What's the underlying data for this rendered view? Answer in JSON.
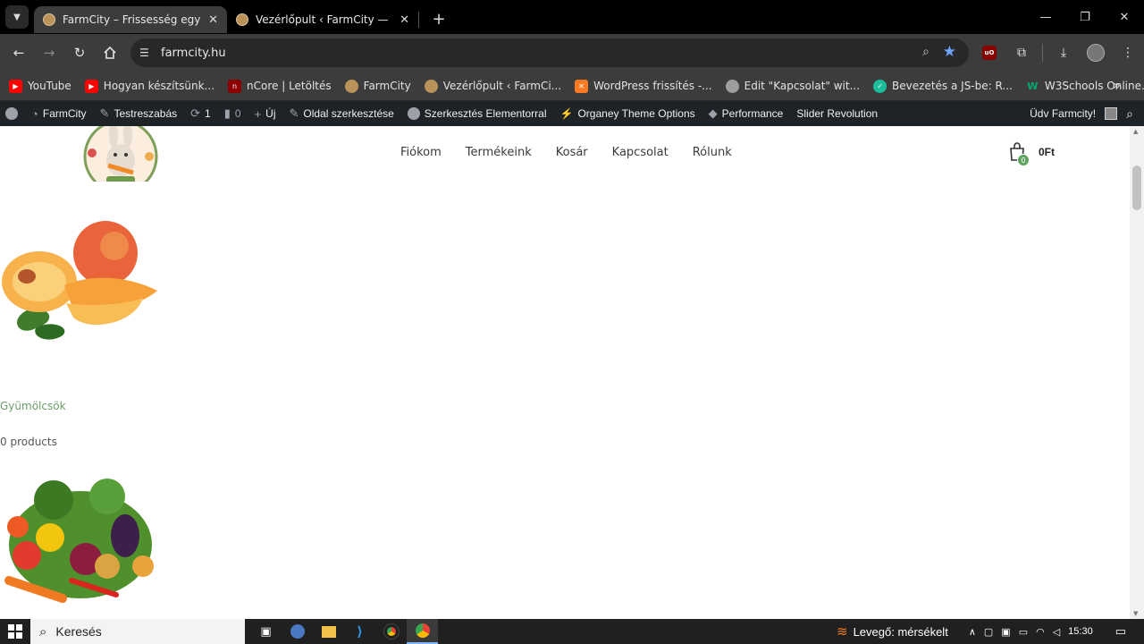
{
  "browser": {
    "tabs": [
      {
        "title": "FarmCity – Frissesség egy kattin",
        "active": true
      },
      {
        "title": "Vezérlőpult ‹ FarmCity — Word",
        "active": false
      }
    ],
    "url": "farmcity.hu",
    "bookmarks": [
      {
        "label": "YouTube",
        "icon": "youtube-icon",
        "color": "#ff0000"
      },
      {
        "label": "Hogyan készítsünk...",
        "icon": "youtube-icon",
        "color": "#ff0000"
      },
      {
        "label": "nCore | Letöltés",
        "icon": "ncore-icon",
        "color": "#8b0000"
      },
      {
        "label": "FarmCity",
        "icon": "farmcity-icon",
        "color": "#b9935a"
      },
      {
        "label": "Vezérlőpult ‹ FarmCi...",
        "icon": "farmcity-icon",
        "color": "#b9935a"
      },
      {
        "label": "WordPress frissítés -...",
        "icon": "xampp-icon",
        "color": "#fb7a24"
      },
      {
        "label": "Edit \"Kapcsolat\" wit...",
        "icon": "globe-icon",
        "color": "#9e9e9e"
      },
      {
        "label": "Bevezetés a JS-be: R...",
        "icon": "shield-icon",
        "color": "#1abc9c"
      },
      {
        "label": "W3Schools Online...",
        "icon": "w3schools-icon",
        "color": "#04aa6d"
      }
    ]
  },
  "wp_admin": {
    "site": "FarmCity",
    "customize": "Testreszabás",
    "updates": "1",
    "comments": "0",
    "new": "Új",
    "edit_page": "Oldal szerkesztése",
    "elementor": "Szerkesztés Elementorral",
    "theme_options": "Organey Theme Options",
    "performance": "Performance",
    "slider": "Slider Revolution",
    "greeting": "Üdv Farmcity!"
  },
  "site": {
    "nav": [
      "Fiókom",
      "Termékeink",
      "Kosár",
      "Kapcsolat",
      "Rólunk"
    ],
    "cart_count": "0",
    "cart_total": "0Ft",
    "category": {
      "name": "Gyümölcsök",
      "count": "0 products"
    }
  },
  "taskbar": {
    "search_placeholder": "Keresés",
    "weather": "Levegő: mérsékelt",
    "time": "15:30"
  }
}
